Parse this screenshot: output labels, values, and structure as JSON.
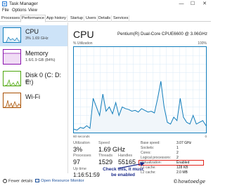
{
  "window": {
    "title": "Task Manager",
    "min": "—",
    "max": "☐",
    "close": "✕"
  },
  "menu": [
    "File",
    "Options",
    "View"
  ],
  "tabs": [
    "Processes",
    "Performance",
    "App history",
    "Startup",
    "Users",
    "Details",
    "Services"
  ],
  "sidebar": {
    "items": [
      {
        "title": "CPU",
        "sub": "3% 1.69 GHz"
      },
      {
        "title": "Memory",
        "sub": "1.6/1.9 GB (84%)"
      },
      {
        "title": "Disk 0 (C: D: E:)",
        "sub": "0%"
      },
      {
        "title": "Wi-Fi",
        "sub": ""
      }
    ]
  },
  "main": {
    "title": "CPU",
    "cpu_name": "Pentium(R) Dual-Core CPUE6600 @ 3.06GHz",
    "util_label": "% Utilization",
    "pct_label": "100%",
    "foot_left": "60 seconds",
    "foot_right": "0",
    "stats": {
      "utilization_label": "Utilization",
      "utilization_value": "3%",
      "speed_label": "Speed",
      "speed_value": "1.69 GHz",
      "processes_label": "Processes",
      "processes_value": "97",
      "threads_label": "Threads",
      "threads_value": "1529",
      "handles_label": "Handles",
      "handles_value": "55165",
      "uptime_label": "Up time",
      "uptime_value": "1:16:51:59"
    },
    "specs": [
      {
        "label": "Base speed:",
        "value": "3.07 GHz"
      },
      {
        "label": "Sockets:",
        "value": "1"
      },
      {
        "label": "Cores:",
        "value": "2"
      },
      {
        "label": "Logical processors:",
        "value": "2"
      },
      {
        "label": "Virtualization:",
        "value": "Enabled"
      },
      {
        "label": "L1 cache:",
        "value": "128 KB"
      },
      {
        "label": "L2 cache:",
        "value": "2.0 MB"
      }
    ]
  },
  "annotation": {
    "line1": "Check this, it must",
    "line2": "be enabled"
  },
  "footer": {
    "fewer_details": "Fewer details",
    "open_monitor": "Open Resource Monitor",
    "watermark": "©howtoedge"
  },
  "colors": {
    "cpu": "#117dbb",
    "memory": "#8b12ae",
    "disk": "#4da60c",
    "wifi": "#a74f01",
    "highlight": "#e2231a"
  },
  "chart_data": {
    "type": "area",
    "title": "CPU",
    "xlabel": "60 seconds",
    "ylabel": "% Utilization",
    "ylim": [
      0,
      100
    ],
    "values": [
      4,
      3,
      6,
      5,
      8,
      5,
      40,
      30,
      20,
      45,
      25,
      30,
      22,
      35,
      20,
      30,
      28,
      27,
      25,
      26,
      24,
      28,
      26,
      24,
      25,
      23,
      40,
      60,
      30,
      12,
      10,
      18,
      14,
      40,
      18,
      12,
      10,
      20,
      10,
      12,
      14,
      8
    ]
  }
}
